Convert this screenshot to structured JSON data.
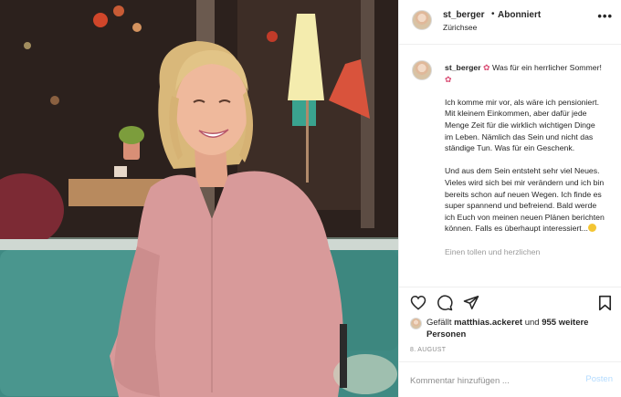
{
  "post": {
    "username": "st_berger",
    "separator": "•",
    "follow_status": "Abonniert",
    "location": "Zürichsee",
    "more_icon": "more-horizontal-icon",
    "caption": {
      "username": "st_berger",
      "line1": "Was für ein herrlicher Sommer!",
      "para2": "Ich komme mir vor, als wäre ich pensioniert. Mit kleinem Einkommen, aber dafür jede Menge Zeit für die wirklich wichtigen Dinge im Leben. Nämlich das Sein und nicht das ständige Tun. Was für ein Geschenk.",
      "para3": "Und aus dem Sein entsteht sehr viel Neues. Vieles wird sich bei mir verändern und ich bin bereits schon auf neuen Wegen. Ich finde es super spannend und befreiend. Bald werde ich Euch von meinen neuen Plänen berichten können. Falls es überhaupt interessiert...",
      "cut_line": "Einen tollen und herzlichen"
    },
    "likes": {
      "prefix": "Gefällt",
      "user": "matthias.ackeret",
      "conjunction": "und",
      "others": "955 weitere Personen"
    },
    "date": "8. AUGUST",
    "comment": {
      "placeholder": "Kommentar hinzufügen ...",
      "post_label": "Posten"
    }
  },
  "icons": {
    "like": "heart-icon",
    "comment": "comment-icon",
    "share": "send-icon",
    "save": "bookmark-icon"
  },
  "colors": {
    "text": "#262626",
    "muted": "#8e8e8e",
    "post_disabled": "#b3dbff",
    "border": "#efefef"
  }
}
